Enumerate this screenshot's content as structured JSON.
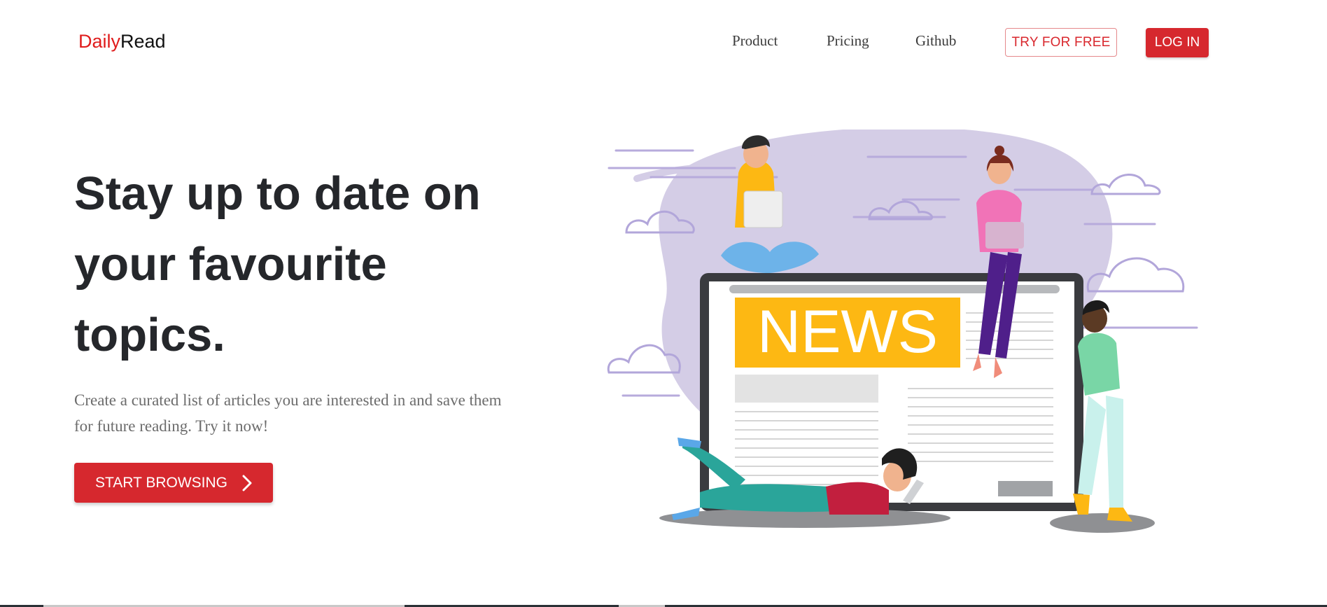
{
  "brand": {
    "accent": "Daily",
    "rest": "Read",
    "accent_color": "#e01d1d"
  },
  "nav": {
    "product": "Product",
    "pricing": "Pricing",
    "github": "Github",
    "try_free": "TRY FOR FREE",
    "login": "LOG IN"
  },
  "hero": {
    "title": "Stay up to date on your favourite topics.",
    "subtitle": "Create a curated list of articles you are interested in and save them for future reading. Try it now!",
    "cta": "START BROWSING",
    "cta_icon": "chevron-right-icon"
  },
  "illustration": {
    "news_label": "NEWS",
    "news_color": "#fdb813",
    "blob_color": "#d4cde6"
  },
  "colors": {
    "primary": "#d6282e",
    "heading": "#25272b",
    "body_text": "#6c6c6c"
  }
}
